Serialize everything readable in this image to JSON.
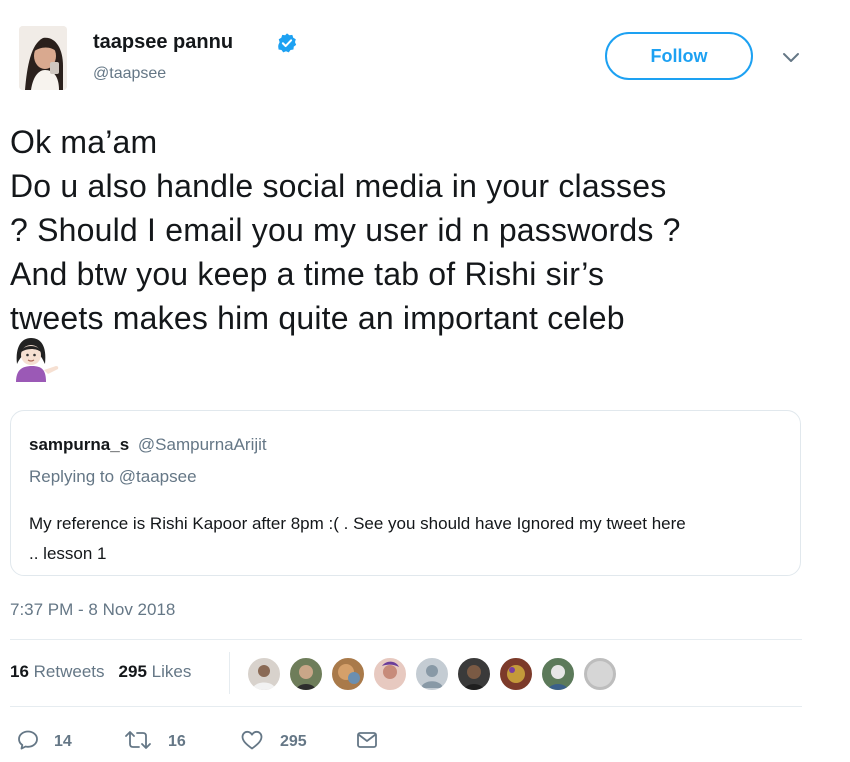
{
  "user": {
    "name": "taapsee pannu",
    "handle": "@taapsee"
  },
  "follow_label": "Follow",
  "tweet": {
    "lines": [
      "Ok ma’am",
      "Do u also handle social media in your classes",
      "? Should I email you my user id n passwords ?",
      "And btw you keep a time tab of Rishi sir’s",
      "tweets makes him quite an important celeb"
    ],
    "emoji": "woman-tipping-hand-icon"
  },
  "quoted": {
    "name": "sampurna_s",
    "handle": "@SampurnaArijit",
    "replying_to": "Replying to @taapsee",
    "text_lines": [
      "My reference is Rishi Kapoor after 8pm :( . See you should have Ignored my tweet here",
      ".. lesson 1"
    ]
  },
  "timestamp": "7:37 PM - 8 Nov 2018",
  "stats": {
    "retweets_count": "16",
    "retweets_label": "Retweets",
    "likes_count": "295",
    "likes_label": "Likes"
  },
  "liker_avatar_count": 9,
  "actions": {
    "replies": "14",
    "retweets": "16",
    "likes": "295"
  },
  "colors": {
    "accent": "#1da1f2",
    "secondary_text": "#657786",
    "border": "#e1e8ed"
  }
}
